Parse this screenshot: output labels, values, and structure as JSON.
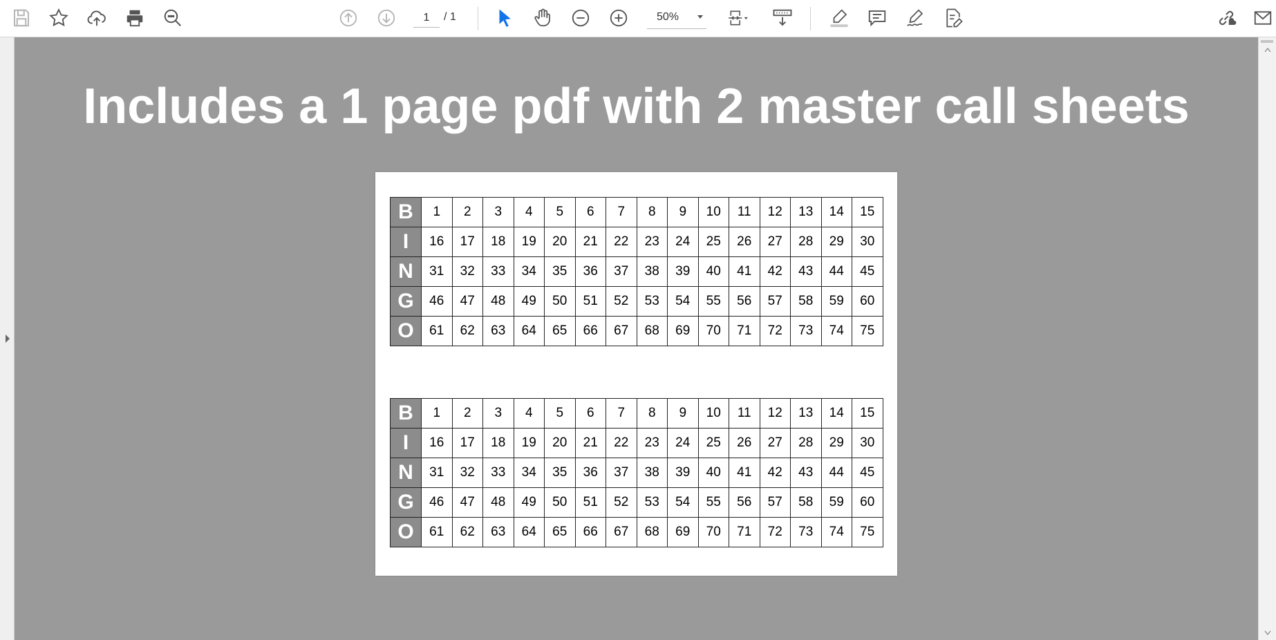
{
  "toolbar": {
    "page_current": "1",
    "page_total": "/ 1",
    "zoom": "50%",
    "left_tools": [
      "save-icon",
      "bookmark-star-icon",
      "upload-cloud-icon",
      "print-icon",
      "search-zoom-icon"
    ],
    "nav_tools": [
      "prev-page-icon",
      "next-page-icon"
    ],
    "view_tools": [
      "select-cursor-icon",
      "hand-pan-icon",
      "zoom-out-icon",
      "zoom-in-icon"
    ],
    "page_tools": [
      "fit-page-icon",
      "scroll-mode-icon"
    ],
    "annotate_tools": [
      "highlight-icon",
      "comment-icon",
      "sign-icon",
      "edit-pdf-icon"
    ],
    "right_tools": [
      "share-link-icon",
      "email-icon"
    ]
  },
  "colors": {
    "accent": "#1473e6",
    "canvas": "#9a9a9a",
    "letter_cell": "#8c8c8c"
  },
  "document": {
    "headline": "Includes a 1 page pdf with 2 master call sheets",
    "call_sheets": [
      {
        "letters": [
          "B",
          "I",
          "N",
          "G",
          "O"
        ],
        "rows": [
          [
            "1",
            "2",
            "3",
            "4",
            "5",
            "6",
            "7",
            "8",
            "9",
            "10",
            "11",
            "12",
            "13",
            "14",
            "15"
          ],
          [
            "16",
            "17",
            "18",
            "19",
            "20",
            "21",
            "22",
            "23",
            "24",
            "25",
            "26",
            "27",
            "28",
            "29",
            "30"
          ],
          [
            "31",
            "32",
            "33",
            "34",
            "35",
            "36",
            "37",
            "38",
            "39",
            "40",
            "41",
            "42",
            "43",
            "44",
            "45"
          ],
          [
            "46",
            "47",
            "48",
            "49",
            "50",
            "51",
            "52",
            "53",
            "54",
            "55",
            "56",
            "57",
            "58",
            "59",
            "60"
          ],
          [
            "61",
            "62",
            "63",
            "64",
            "65",
            "66",
            "67",
            "68",
            "69",
            "70",
            "71",
            "72",
            "73",
            "74",
            "75"
          ]
        ]
      },
      {
        "letters": [
          "B",
          "I",
          "N",
          "G",
          "O"
        ],
        "rows": [
          [
            "1",
            "2",
            "3",
            "4",
            "5",
            "6",
            "7",
            "8",
            "9",
            "10",
            "11",
            "12",
            "13",
            "14",
            "15"
          ],
          [
            "16",
            "17",
            "18",
            "19",
            "20",
            "21",
            "22",
            "23",
            "24",
            "25",
            "26",
            "27",
            "28",
            "29",
            "30"
          ],
          [
            "31",
            "32",
            "33",
            "34",
            "35",
            "36",
            "37",
            "38",
            "39",
            "40",
            "41",
            "42",
            "43",
            "44",
            "45"
          ],
          [
            "46",
            "47",
            "48",
            "49",
            "50",
            "51",
            "52",
            "53",
            "54",
            "55",
            "56",
            "57",
            "58",
            "59",
            "60"
          ],
          [
            "61",
            "62",
            "63",
            "64",
            "65",
            "66",
            "67",
            "68",
            "69",
            "70",
            "71",
            "72",
            "73",
            "74",
            "75"
          ]
        ]
      }
    ]
  }
}
